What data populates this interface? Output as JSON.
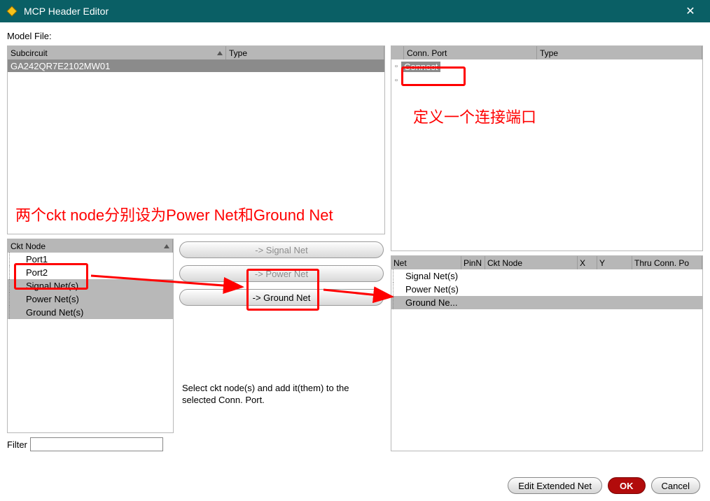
{
  "window": {
    "title": "MCP Header Editor",
    "close_glyph": "✕"
  },
  "model_file_label": "Model File:",
  "subckt_table": {
    "headers": {
      "subcircuit": "Subcircuit",
      "type": "Type"
    },
    "rows": [
      {
        "subcircuit": "GA242QR7E2102MW01"
      }
    ]
  },
  "ckt_node": {
    "header": "Ckt Node",
    "items": [
      {
        "label": "Port1"
      },
      {
        "label": "Port2"
      },
      {
        "label": "Signal Net(s)"
      },
      {
        "label": "Power Net(s)"
      },
      {
        "label": "Ground Net(s)"
      }
    ]
  },
  "mid_buttons": {
    "to_signal": "-> Signal Net",
    "to_power": "-> Power Net",
    "to_ground": "-> Ground Net"
  },
  "hint_text": "Select ckt node(s)  and add it(them) to the selected Conn. Port.",
  "filter_label": "Filter",
  "conn_port_table": {
    "headers": {
      "conn_port": "Conn. Port",
      "type": "Type"
    },
    "rows": [
      {
        "name": "Connect"
      }
    ]
  },
  "net_table": {
    "headers": {
      "net": "Net",
      "pinn": "PinN",
      "ckt": "Ckt Node",
      "x": "X",
      "y": "Y",
      "thru": "Thru Conn. Po"
    },
    "items": [
      {
        "label": "Signal Net(s)"
      },
      {
        "label": "Power Net(s)"
      },
      {
        "label": "Ground Ne..."
      }
    ]
  },
  "footer": {
    "edit_ext": "Edit Extended Net",
    "ok": "OK",
    "cancel": "Cancel"
  },
  "annotations": {
    "top_right": "定义一个连接端口",
    "left_large": "两个ckt node分别设为Power Net和Ground Net"
  }
}
